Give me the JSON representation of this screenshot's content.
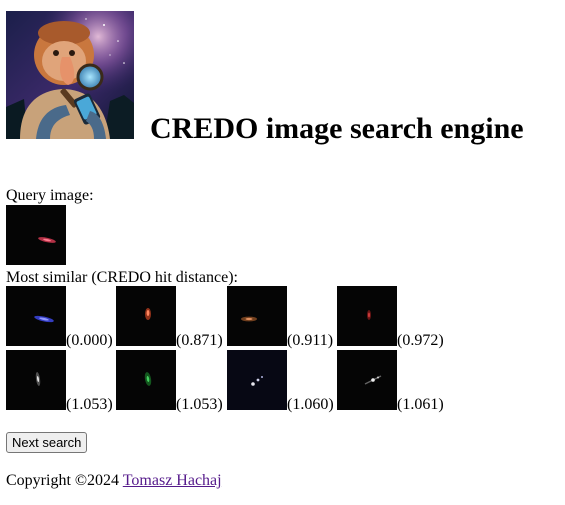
{
  "header": {
    "title": "CREDO image search engine",
    "logo_icon": "proboscis-monkey-detective-logo"
  },
  "query": {
    "label": "Query image:",
    "image": {
      "icon": "red-particle-track"
    }
  },
  "results": {
    "label": "Most similar (CREDO hit distance):",
    "items": [
      {
        "distance": "(0.000)",
        "icon": "blue-particle-track"
      },
      {
        "distance": "(0.871)",
        "icon": "red-blob-track"
      },
      {
        "distance": "(0.911)",
        "icon": "orange-dim-track"
      },
      {
        "distance": "(0.972)",
        "icon": "red-faint-track"
      },
      {
        "distance": "(1.053)",
        "icon": "white-streak-track"
      },
      {
        "distance": "(1.053)",
        "icon": "green-track"
      },
      {
        "distance": "(1.060)",
        "icon": "white-dots-track"
      },
      {
        "distance": "(1.061)",
        "icon": "white-line-track"
      }
    ]
  },
  "actions": {
    "next_search_label": "Next search"
  },
  "footer": {
    "copyright_prefix": "Copyright ©2024",
    "author_name": "Tomasz Hachaj"
  },
  "colors": {
    "link_visited": "#551a8b",
    "thumbnail_background": "#050505",
    "button_background": "#efefef"
  }
}
